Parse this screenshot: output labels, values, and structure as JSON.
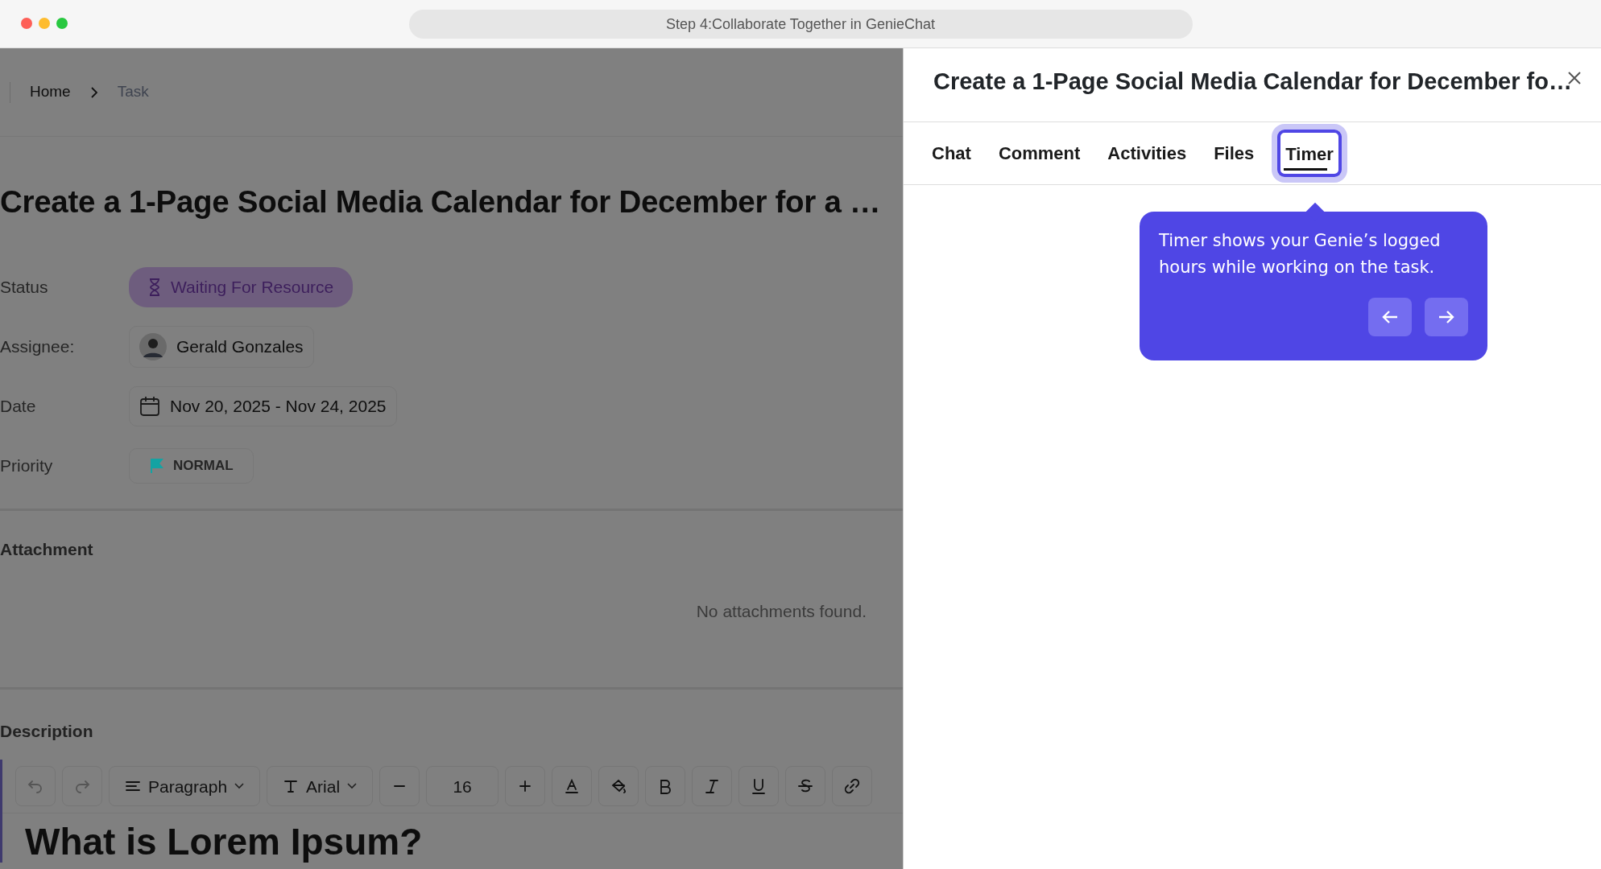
{
  "window": {
    "title": "Step 4:Collaborate Together in GenieChat"
  },
  "breadcrumb": [
    {
      "label": "Home",
      "current": false
    },
    {
      "label": "Task",
      "current": true
    }
  ],
  "task": {
    "title": "Create a 1-Page Social Media Calendar for December for a …",
    "fields": [
      {
        "kind": "status",
        "label": "Status",
        "value": "Waiting For Resource"
      },
      {
        "kind": "assignee",
        "label": "Assignee:",
        "value": "Gerald Gonzales"
      },
      {
        "kind": "date",
        "label": "Date",
        "value": "Nov 20, 2025 - Nov 24, 2025"
      },
      {
        "kind": "priority",
        "label": "Priority",
        "value": "NORMAL",
        "color": "#14a3a3"
      }
    ]
  },
  "attachment": {
    "heading": "Attachment",
    "empty_text": "No attachments found."
  },
  "description": {
    "heading": "Description",
    "toolbar": {
      "block_style": "Paragraph",
      "font": "Arial",
      "font_size": "16"
    },
    "content_heading": "What is Lorem Ipsum?"
  },
  "panel": {
    "title": "Create a 1-Page Social Media Calendar for December fo…",
    "tabs": [
      {
        "label": "Chat",
        "selected": false
      },
      {
        "label": "Comment",
        "selected": false
      },
      {
        "label": "Activities",
        "selected": false
      },
      {
        "label": "Files",
        "selected": false
      },
      {
        "label": "Timer",
        "selected": true
      }
    ],
    "tooltip": {
      "text": "Timer shows your Genie’s logged hours while working on the task."
    }
  }
}
